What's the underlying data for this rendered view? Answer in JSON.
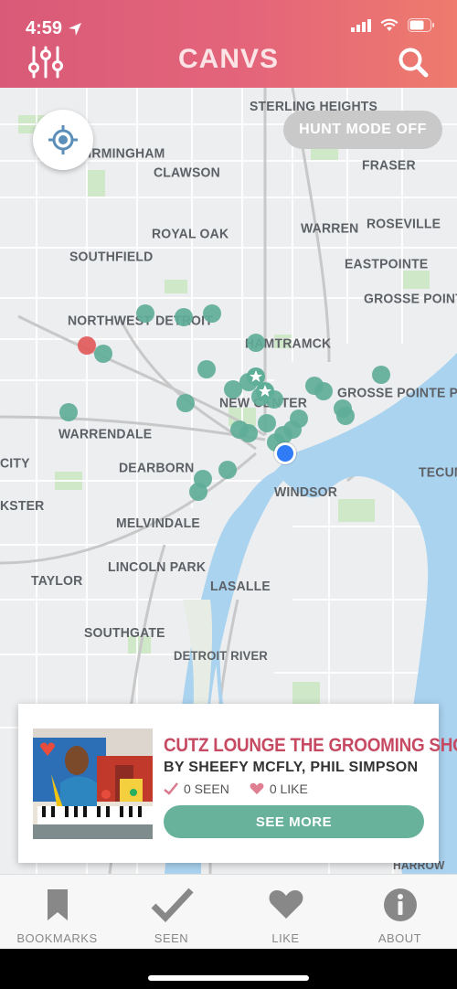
{
  "status_bar": {
    "time": "4:59"
  },
  "header": {
    "logo": "CANVS"
  },
  "map": {
    "hunt_mode_label": "HUNT MODE OFF",
    "labels": [
      "STERLING HEIGHTS",
      "FRASER",
      "BIRMINGHAM",
      "CLAWSON",
      "ROYAL OAK",
      "WARREN",
      "ROSEVILLE",
      "SOUTHFIELD",
      "EASTPOINTE",
      "GROSSE POINTE W",
      "NORTHWEST DETROIT",
      "HAMTRAMCK",
      "GROSSE POINTE PARK",
      "NEW CENTER",
      "WARRENDALE",
      "CITY",
      "DEARBORN",
      "WINDSOR",
      "TECUMS",
      "KSTER",
      "MELVINDALE",
      "LINCOLN PARK",
      "TAYLOR",
      "LASALLE",
      "SOUTHGATE",
      "DETROIT RIVER",
      "HARROW"
    ]
  },
  "card": {
    "title": "CUTZ LOUNGE THE GROOMING SHOP",
    "artists": "BY SHEEFY MCFLY, PHIL SIMPSON",
    "seen": "0 SEEN",
    "like": "0 LIKE",
    "see_more": "SEE MORE"
  },
  "nav": {
    "bookmarks": "BOOKMARKS",
    "seen": "SEEN",
    "like": "LIKE",
    "about": "ABOUT"
  },
  "colors": {
    "header_start": "#d85a78",
    "header_end": "#ee7b6d",
    "accent_green": "#68b19a",
    "title_red": "#c74a63",
    "marker_green": "#5fae98",
    "marker_red": "#e25a5a",
    "location_blue": "#2f7cf6",
    "water": "#aad3f0"
  },
  "icons": [
    "location-arrow-icon",
    "signal-icon",
    "wifi-icon",
    "battery-icon",
    "filter-sliders-icon",
    "search-icon",
    "crosshair-icon",
    "check-icon",
    "heart-icon",
    "bookmark-icon",
    "info-icon"
  ]
}
